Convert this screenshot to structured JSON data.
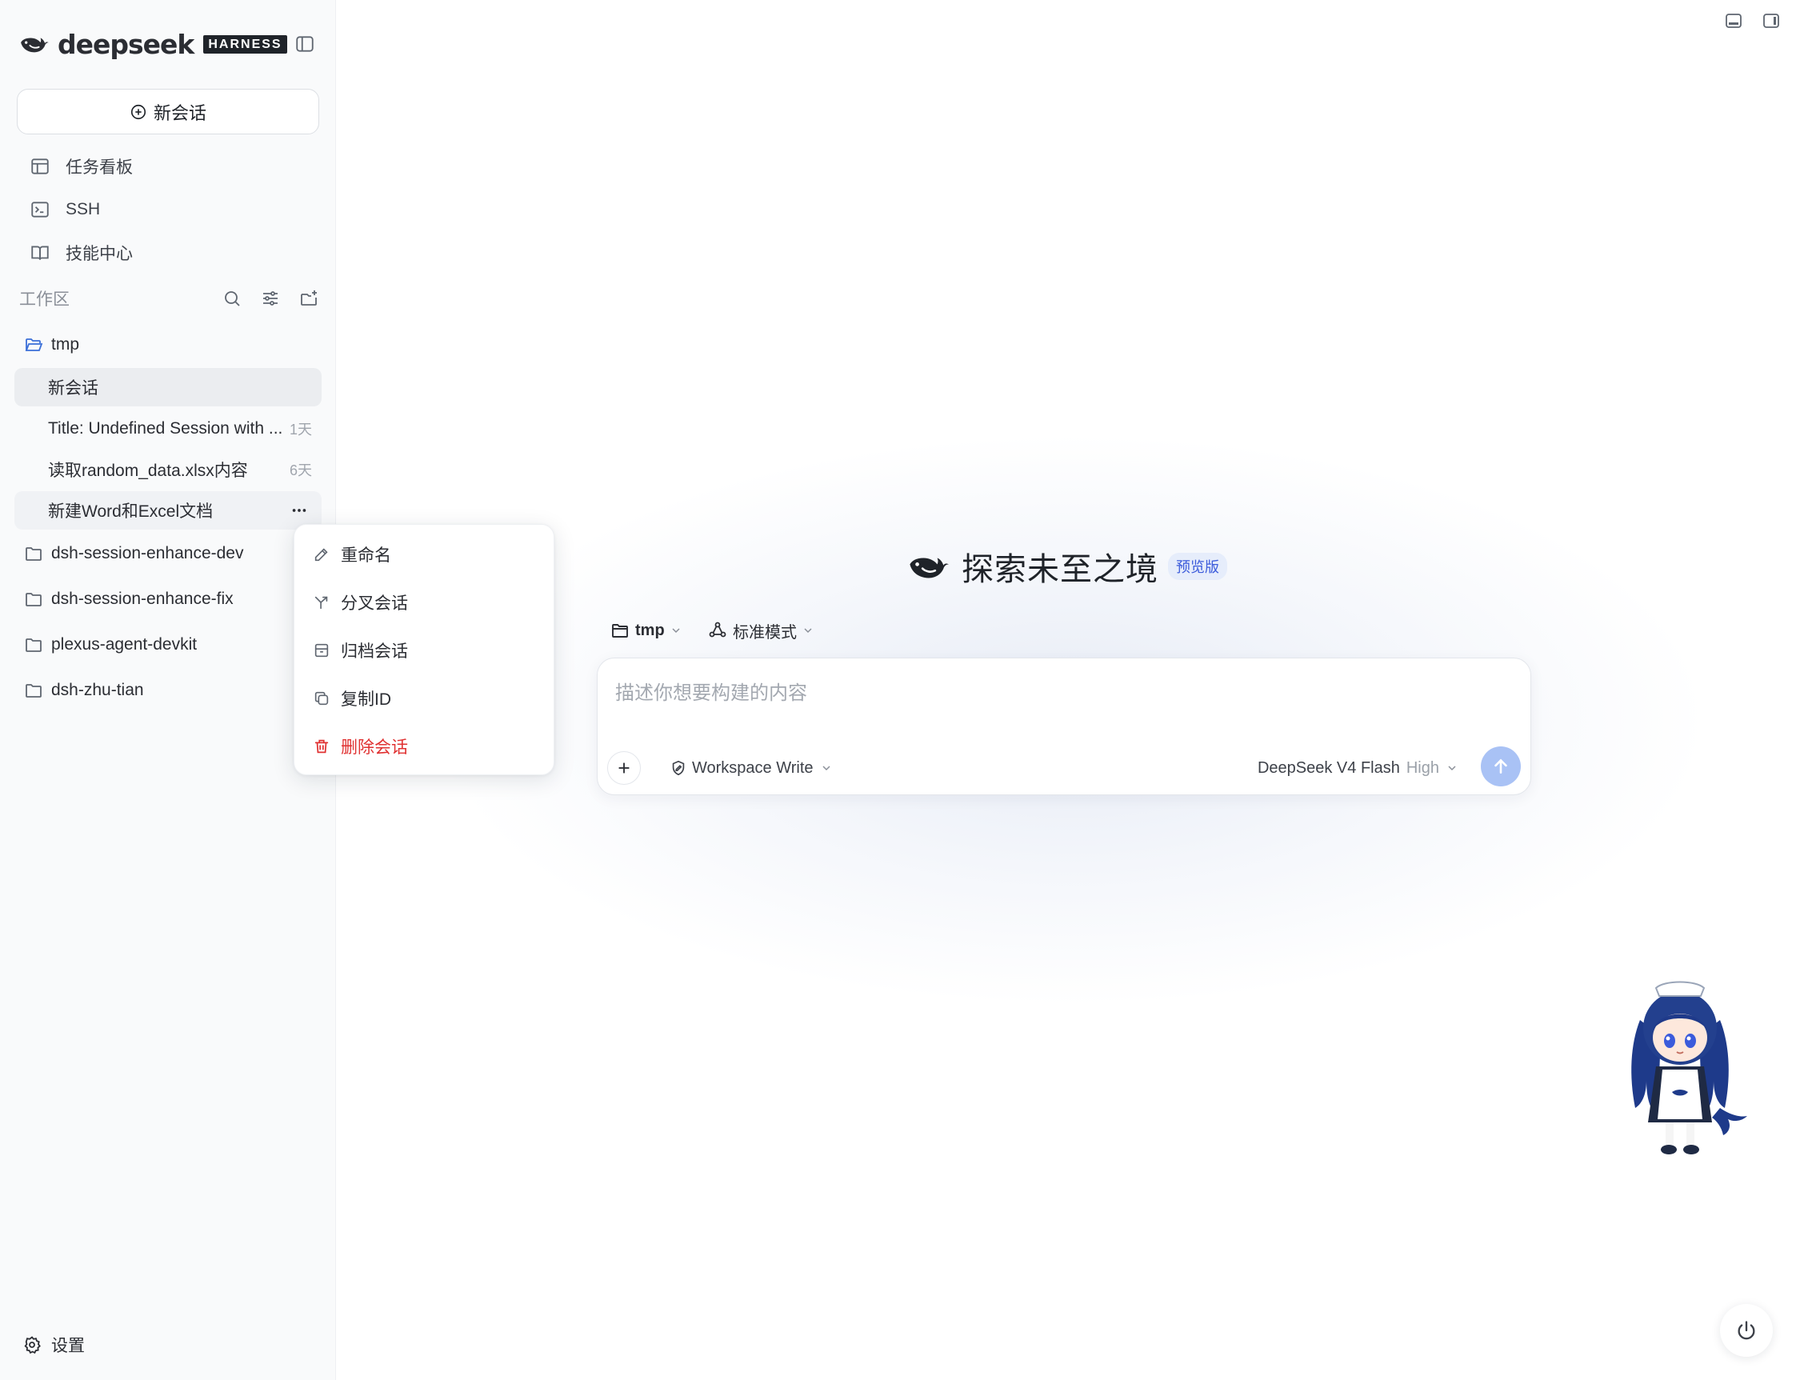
{
  "brand": {
    "name": "deepseek",
    "badge": "HARNESS"
  },
  "sidebar": {
    "new_chat_label": "新会话",
    "nav": [
      {
        "label": "任务看板",
        "icon": "kanban-icon"
      },
      {
        "label": "SSH",
        "icon": "terminal-icon"
      },
      {
        "label": "技能中心",
        "icon": "book-icon"
      }
    ],
    "workspace": {
      "title": "工作区",
      "tools": [
        "search-icon",
        "filter-icon",
        "new-folder-icon"
      ],
      "folders": [
        {
          "name": "tmp",
          "expanded": true,
          "sessions": [
            {
              "label": "新会话",
              "age": ""
            },
            {
              "label": "Title: Undefined Session with ...",
              "age": "1天"
            },
            {
              "label": "读取random_data.xlsx内容",
              "age": "6天"
            },
            {
              "label": "新建Word和Excel文档",
              "age": ""
            }
          ]
        },
        {
          "name": "dsh-session-enhance-dev"
        },
        {
          "name": "dsh-session-enhance-fix"
        },
        {
          "name": "plexus-agent-devkit"
        },
        {
          "name": "dsh-zhu-tian"
        }
      ]
    },
    "settings_label": "设置"
  },
  "context_menu": {
    "items": [
      {
        "label": "重命名",
        "icon": "pencil-icon"
      },
      {
        "label": "分叉会话",
        "icon": "fork-icon"
      },
      {
        "label": "归档会话",
        "icon": "archive-icon"
      },
      {
        "label": "复制ID",
        "icon": "copy-icon"
      },
      {
        "label": "删除会话",
        "icon": "trash-icon",
        "danger": true
      }
    ],
    "danger_color": "#e03131"
  },
  "main": {
    "hero_title": "探索未至之境",
    "hero_badge": "预览版",
    "folder_picker": "tmp",
    "mode_picker": "标准模式",
    "composer": {
      "placeholder": "描述你想要构建的内容",
      "value": "",
      "permission": "Workspace Write",
      "model": "DeepSeek V4 Flash",
      "effort": "High"
    }
  },
  "colors": {
    "sidebar_bg": "#f9fafb",
    "active_item_bg": "#ebedf0",
    "send_button": "#a9c2f5",
    "badge_bg": "#e6edfb",
    "badge_text": "#3b5bdb"
  }
}
